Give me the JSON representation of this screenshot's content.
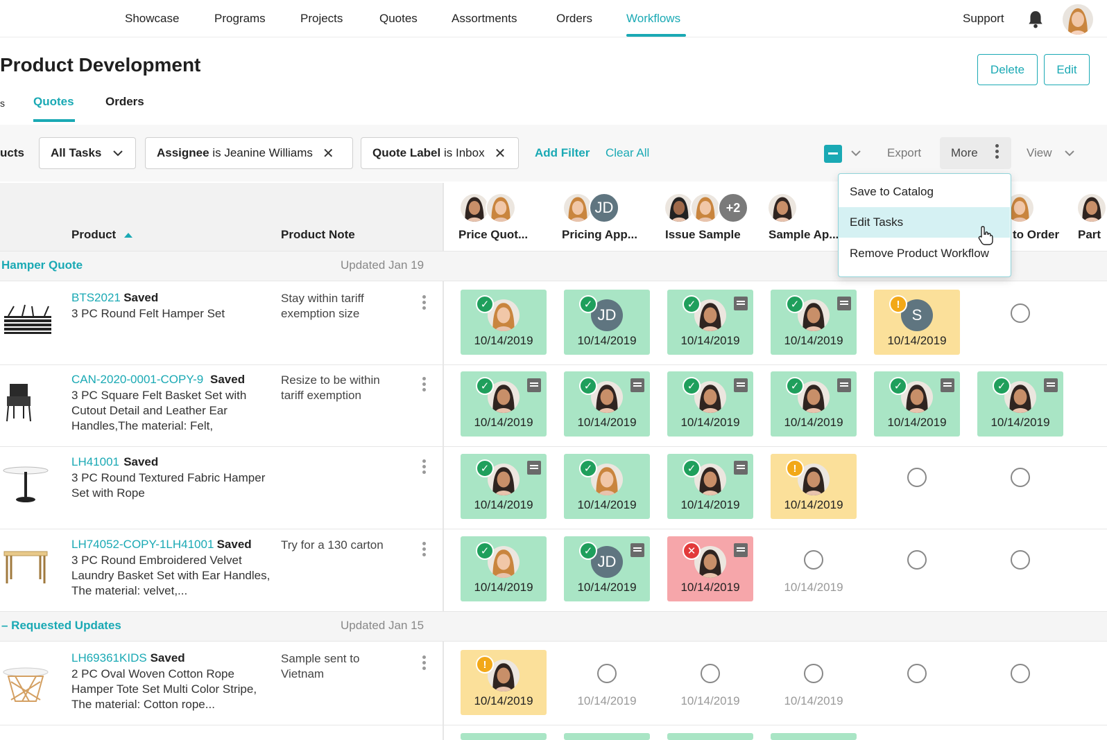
{
  "nav": {
    "items": [
      "Showcase",
      "Programs",
      "Projects",
      "Quotes",
      "Assortments",
      "Orders",
      "Workflows"
    ],
    "active": "Workflows",
    "support": "Support"
  },
  "header": {
    "title": "Product Development",
    "delete_label": "Delete",
    "edit_label": "Edit",
    "tabs": [
      "Quotes",
      "Orders"
    ],
    "active_tab": "Quotes",
    "left_cut_mark": "s"
  },
  "filters": {
    "cut_label": "ucts",
    "all_tasks": "All Tasks",
    "chip1_field": "Assignee",
    "chip1_op": "is",
    "chip1_value": "Jeanine Williams",
    "chip2_field": "Quote Label",
    "chip2_op": "is",
    "chip2_value": "Inbox",
    "add_filter": "Add Filter",
    "clear_all": "Clear All",
    "export": "Export",
    "more": "More",
    "view": "View"
  },
  "dropdown": {
    "items": [
      "Save to Catalog",
      "Edit Tasks",
      "Remove Product Workflow"
    ],
    "hover_index": 1
  },
  "columns": {
    "product": "Product",
    "product_note": "Product Note",
    "tasks": [
      "Price Quot...",
      "Pricing App...",
      "Issue Sample",
      "Sample Ap...",
      "to Order",
      "Part"
    ],
    "plus_count": "+2",
    "jd": "JD"
  },
  "groups": [
    {
      "title": "Hamper Quote",
      "updated": "Updated Jan 19"
    },
    {
      "title": "Requested Updates",
      "updated": "Updated Jan 15",
      "prefix": "–"
    }
  ],
  "rows": [
    {
      "sku": "BTS2021",
      "status": "Saved",
      "desc": "3 PC Round Felt Hamper Set",
      "note": "Stay within tariff exemption size",
      "cells": [
        "green",
        "green",
        "green",
        "green",
        "yellow",
        "empty"
      ]
    },
    {
      "sku": "CAN-2020-0001-COPY-9",
      "status": "Saved",
      "desc": "3 PC Square Felt Basket Set with Cutout Detail and Leather Ear Handles,The material: Felt,",
      "note": "Resize to be within tariff exemption",
      "cells": [
        "green",
        "green",
        "green",
        "green",
        "green",
        "green"
      ]
    },
    {
      "sku": "LH41001",
      "status": "Saved",
      "desc": "3 PC Round Textured Fabric Hamper Set with Rope",
      "note": "",
      "cells": [
        "green",
        "green",
        "green",
        "yellow",
        "empty",
        "empty"
      ]
    },
    {
      "sku": "LH74052-COPY-1LH41001",
      "status": "Saved",
      "desc": "3 PC Round Embroidered Velvet Laundry Basket Set with Ear Handles, The material: velvet,...",
      "note": "Try for a 130 carton",
      "cells": [
        "green",
        "green",
        "red",
        "empty-date",
        "empty",
        "empty"
      ]
    },
    {
      "sku": "LH69361KIDS",
      "status": "Saved",
      "desc": "2 PC Oval Woven Cotton Rope Hamper Tote Set Multi Color Stripe, The material: Cotton rope...",
      "note": "Sample sent to Vietnam",
      "cells": [
        "yellow",
        "empty-date",
        "empty-date",
        "empty-date",
        "empty",
        "empty"
      ]
    }
  ],
  "cell_date": "10/14/2019",
  "cell_letter_s": "S",
  "colors": {
    "accent": "#1aa9b4",
    "done": "#a9e5c5",
    "warn": "#fbe09a",
    "error": "#f6a6aa"
  }
}
